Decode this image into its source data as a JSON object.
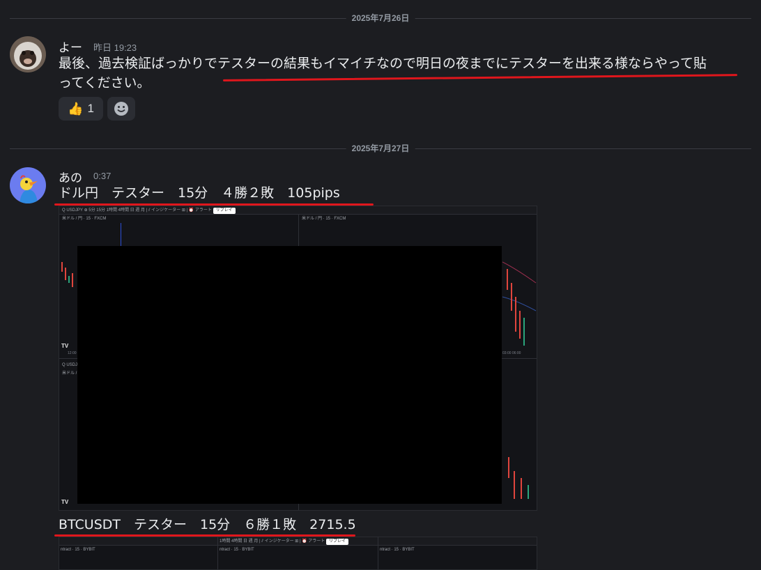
{
  "dividers": {
    "first": "2025年7月26日",
    "second": "2025年7月27日"
  },
  "message1": {
    "username": "よー",
    "timestamp": "昨日 19:23",
    "line1": "最後、過去検証ばっかりでテスターの結果もイマイチなので明日の夜までにテスターを出来る様ならやって貼",
    "line2": "ってください。",
    "reactions": [
      {
        "icon": "thumbs-up-icon",
        "emoji": "👍",
        "count": "1"
      }
    ]
  },
  "message2": {
    "username": "あの",
    "timestamp": "0:37",
    "caption1": "ドル円　テスター　15分　４勝２敗　105pips",
    "caption2": "BTCUSDT　テスター　15分　６勝１敗　2715.5",
    "screenshot1": {
      "toolbar": "Q USDJPY  ⊕  5分 15分 1時間 4時間 日  週  月 | ⫽  インジケーター  ⊞ | ⏰ アラート",
      "replay": "リプレイ",
      "pane_title_left": "米ドル / 円 · 15 · FXCM",
      "pane_title_right": "米ドル / 円 · 15 · FXCM",
      "pane_title_bottom": "米ドル / 円",
      "toolbar_bottom": "Q USDJPY",
      "logo": "TV",
      "axis_left": "12:00",
      "axis_right": "03:00   06:00"
    },
    "screenshot2": {
      "toolbar": "1時間  4時間  日  週  月 | ⫽  インジケーター  ⊞ | ⏰ アラート",
      "replay": "リプレイ",
      "pane_left": "ntract · 15 · BYBIT",
      "pane_mid": "ntract · 15 · BYBIT",
      "pane_right": "ntract · 15 · BYBIT"
    }
  },
  "colors": {
    "background": "#1c1d21",
    "underline": "#e0161c",
    "reaction_bg": "#2b2d33"
  }
}
